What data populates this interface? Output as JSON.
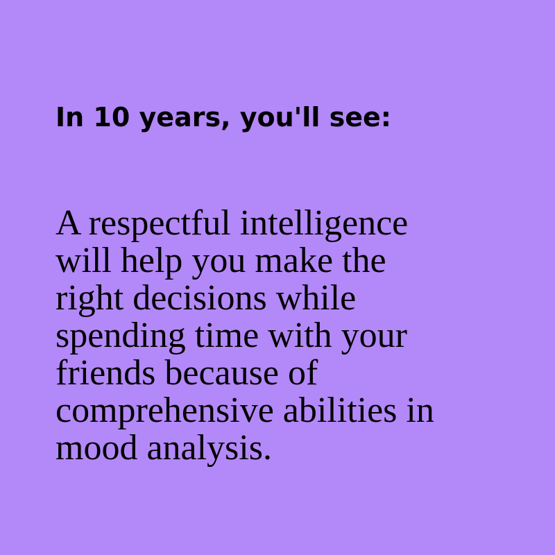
{
  "colors": {
    "background": "#b388f8",
    "text": "#000000"
  },
  "heading": "In 10 years, you'll see:",
  "body_lines": [
    "A respectful intelligence",
    "will help you make the",
    "right decisions while",
    "spending time with your",
    "friends because of",
    "comprehensive abilities in",
    "mood analysis."
  ]
}
